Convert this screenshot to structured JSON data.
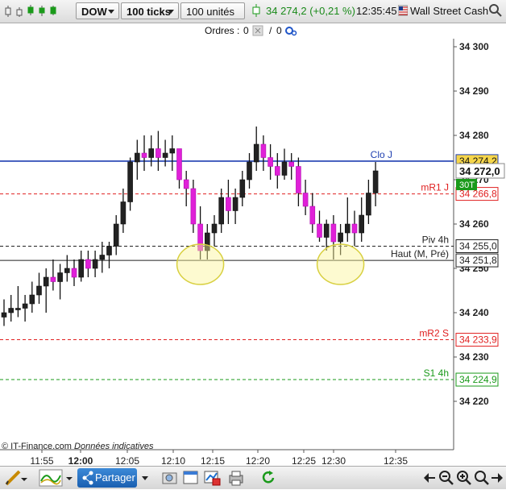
{
  "toolbar": {
    "symbol": "DOW",
    "ticks": "100 ticks",
    "units": "100 unités",
    "price": "34 274,2 (+0,21 %)",
    "time": "12:35:45",
    "instrument": "Wall Street Cash"
  },
  "orders": {
    "label": "Ordres :",
    "count_a": "0",
    "sep": "/",
    "count_b": "0"
  },
  "footer": {
    "brand": "© IT-Finance.com",
    "note": "Données indicatives"
  },
  "bottom": {
    "share_label": "Partager"
  },
  "chart_data": {
    "type": "candlestick",
    "ylim": [
      34231,
      34301
    ],
    "yticks": [
      "34 300",
      "34 290",
      "34 280",
      "34 270",
      "34 260",
      "34 250",
      "34 240",
      "34 230",
      "34 220"
    ],
    "ytick_values": [
      34300,
      34290,
      34280,
      34270,
      34260,
      34250,
      34240,
      34230,
      34220
    ],
    "xticks": [
      "11:55",
      "12:00",
      "12:05",
      "12:10",
      "12:15",
      "12:20",
      "12:25",
      "12:30",
      "12:35"
    ],
    "levels": [
      {
        "name": "Clo J",
        "value": 34274.2,
        "label": "34 274,2",
        "color": "#1f3fb0",
        "style": "solid"
      },
      {
        "name": "mR1 J",
        "value": 34266.8,
        "label": "34 266,8",
        "color": "#e02020",
        "style": "dashed"
      },
      {
        "name": "Piv 4h",
        "value": 34255.0,
        "label": "34 255,0",
        "color": "#222222",
        "style": "dashed"
      },
      {
        "name": "Haut (M, Pré)",
        "value": 34251.8,
        "label": "34 251,8",
        "color": "#222222",
        "style": "solid"
      },
      {
        "name": "mR2 S",
        "value": 34233.9,
        "label": "34 233,9",
        "color": "#e02020",
        "style": "dashed"
      },
      {
        "name": "S1 4h",
        "value": 34224.9,
        "label": "34 224,9",
        "color": "#1a9a1a",
        "style": "dashed"
      }
    ],
    "current_price": {
      "label": "34 272,0",
      "countdown": "30T"
    },
    "candles": [
      {
        "o": 34239,
        "h": 34243,
        "l": 34237,
        "c": 34240
      },
      {
        "o": 34240,
        "h": 34244,
        "l": 34238,
        "c": 34241
      },
      {
        "o": 34241,
        "h": 34246,
        "l": 34239,
        "c": 34241
      },
      {
        "o": 34241,
        "h": 34244,
        "l": 34238,
        "c": 34242
      },
      {
        "o": 34242,
        "h": 34247,
        "l": 34240,
        "c": 34244
      },
      {
        "o": 34244,
        "h": 34249,
        "l": 34242,
        "c": 34246
      },
      {
        "o": 34246,
        "h": 34250,
        "l": 34240,
        "c": 34248
      },
      {
        "o": 34248,
        "h": 34252,
        "l": 34245,
        "c": 34247
      },
      {
        "o": 34247,
        "h": 34251,
        "l": 34243,
        "c": 34249
      },
      {
        "o": 34249,
        "h": 34253,
        "l": 34247,
        "c": 34250
      },
      {
        "o": 34250,
        "h": 34252,
        "l": 34246,
        "c": 34248
      },
      {
        "o": 34248,
        "h": 34254,
        "l": 34247,
        "c": 34252
      },
      {
        "o": 34252,
        "h": 34254,
        "l": 34248,
        "c": 34250
      },
      {
        "o": 34250,
        "h": 34254,
        "l": 34248,
        "c": 34252
      },
      {
        "o": 34252,
        "h": 34256,
        "l": 34249,
        "c": 34253
      },
      {
        "o": 34253,
        "h": 34256,
        "l": 34250,
        "c": 34255
      },
      {
        "o": 34255,
        "h": 34262,
        "l": 34253,
        "c": 34260
      },
      {
        "o": 34260,
        "h": 34268,
        "l": 34258,
        "c": 34265
      },
      {
        "o": 34265,
        "h": 34275,
        "l": 34263,
        "c": 34274
      },
      {
        "o": 34274,
        "h": 34279,
        "l": 34270,
        "c": 34276
      },
      {
        "o": 34276,
        "h": 34280,
        "l": 34272,
        "c": 34275
      },
      {
        "o": 34275,
        "h": 34280,
        "l": 34273,
        "c": 34277
      },
      {
        "o": 34277,
        "h": 34281,
        "l": 34272,
        "c": 34275
      },
      {
        "o": 34275,
        "h": 34279,
        "l": 34273,
        "c": 34276
      },
      {
        "o": 34276,
        "h": 34280,
        "l": 34272,
        "c": 34277
      },
      {
        "o": 34277,
        "h": 34277,
        "l": 34268,
        "c": 34270
      },
      {
        "o": 34270,
        "h": 34272,
        "l": 34264,
        "c": 34268
      },
      {
        "o": 34268,
        "h": 34270,
        "l": 34258,
        "c": 34260
      },
      {
        "o": 34260,
        "h": 34264,
        "l": 34252,
        "c": 34254
      },
      {
        "o": 34254,
        "h": 34260,
        "l": 34252,
        "c": 34258
      },
      {
        "o": 34258,
        "h": 34262,
        "l": 34255,
        "c": 34260
      },
      {
        "o": 34260,
        "h": 34268,
        "l": 34258,
        "c": 34266
      },
      {
        "o": 34266,
        "h": 34270,
        "l": 34260,
        "c": 34263
      },
      {
        "o": 34263,
        "h": 34268,
        "l": 34260,
        "c": 34266
      },
      {
        "o": 34266,
        "h": 34272,
        "l": 34264,
        "c": 34270
      },
      {
        "o": 34270,
        "h": 34276,
        "l": 34268,
        "c": 34274
      },
      {
        "o": 34274,
        "h": 34282,
        "l": 34272,
        "c": 34278
      },
      {
        "o": 34278,
        "h": 34280,
        "l": 34272,
        "c": 34275
      },
      {
        "o": 34275,
        "h": 34278,
        "l": 34270,
        "c": 34273
      },
      {
        "o": 34273,
        "h": 34276,
        "l": 34268,
        "c": 34271
      },
      {
        "o": 34271,
        "h": 34277,
        "l": 34270,
        "c": 34274
      },
      {
        "o": 34274,
        "h": 34276,
        "l": 34270,
        "c": 34273
      },
      {
        "o": 34273,
        "h": 34275,
        "l": 34264,
        "c": 34267
      },
      {
        "o": 34267,
        "h": 34270,
        "l": 34262,
        "c": 34264
      },
      {
        "o": 34264,
        "h": 34267,
        "l": 34258,
        "c": 34260
      },
      {
        "o": 34260,
        "h": 34263,
        "l": 34256,
        "c": 34257
      },
      {
        "o": 34257,
        "h": 34261,
        "l": 34254,
        "c": 34260
      },
      {
        "o": 34260,
        "h": 34262,
        "l": 34252,
        "c": 34256
      },
      {
        "o": 34256,
        "h": 34260,
        "l": 34253,
        "c": 34258
      },
      {
        "o": 34258,
        "h": 34266,
        "l": 34256,
        "c": 34260
      },
      {
        "o": 34260,
        "h": 34263,
        "l": 34255,
        "c": 34258
      },
      {
        "o": 34258,
        "h": 34266,
        "l": 34256,
        "c": 34262
      },
      {
        "o": 34262,
        "h": 34270,
        "l": 34260,
        "c": 34267
      },
      {
        "o": 34267,
        "h": 34274,
        "l": 34264,
        "c": 34272
      }
    ],
    "circles": [
      {
        "index": 28,
        "value": 34252
      },
      {
        "index": 48,
        "value": 34252
      }
    ]
  }
}
